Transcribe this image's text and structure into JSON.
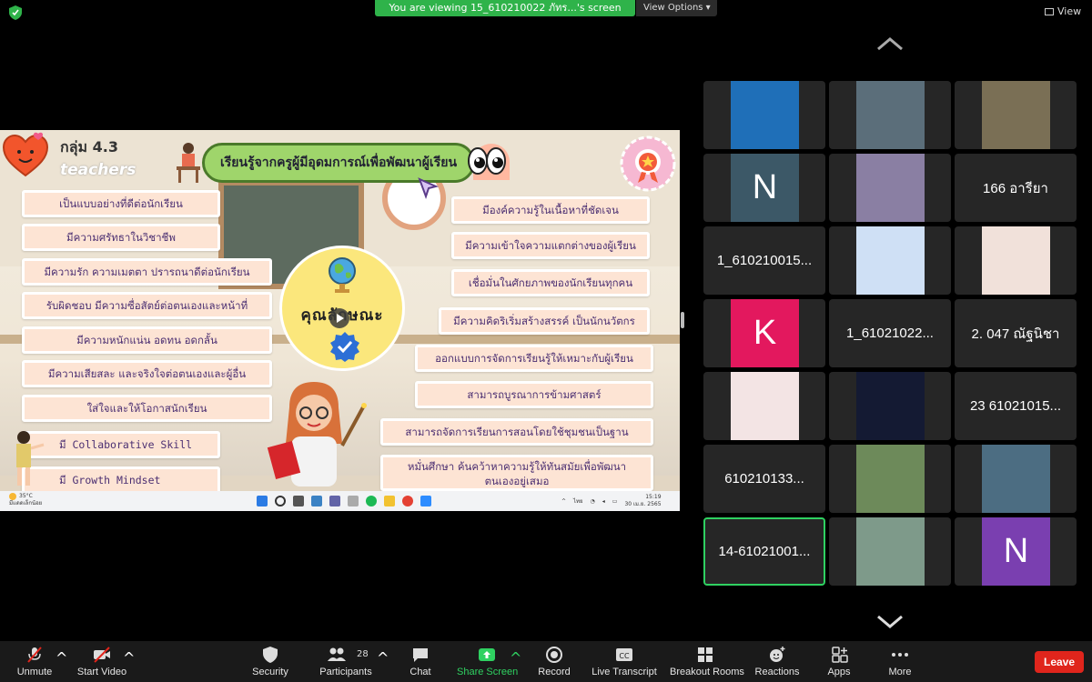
{
  "top_bar": {
    "banner_text": "You are viewing 15_610210022 ภัทร...'s screen",
    "view_options_label": "View Options",
    "view_label": "View"
  },
  "slide": {
    "group_label": "กลุ่ม 4.3",
    "teachers_label": "teachers",
    "title": "เรียนรู้จากครูผู้มีอุดมการณ์เพื่อพัฒนาผู้เรียน",
    "center_title": "คุณลักษณะ",
    "left_items": [
      "เป็นแบบอย่างที่ดีต่อนักเรียน",
      "มีความศรัทธาในวิชาชีพ",
      "มีความรัก ความเมตตา ปรารถนาดีต่อนักเรียน",
      "รับผิดชอบ มีความซื่อสัตย์ต่อตนเองและหน้าที่",
      "มีความหนักแน่น อดทน อดกลั้น",
      "มีความเสียสละ และจริงใจต่อตนเองและผู้อื่น",
      "ใส่ใจและให้โอกาสนักเรียน",
      "มี Collaborative Skill",
      "มี Growth Mindset"
    ],
    "right_items": [
      "มีองค์ความรู้ในเนื้อหาที่ชัดเจน",
      "มีความเข้าใจความแตกต่างของผู้เรียน",
      "เชื่อมั่นในศักยภาพของนักเรียนทุกคน",
      "มีความคิดริเริ่มสร้างสรรค์ เป็นนักนวัตกร",
      "ออกแบบการจัดการเรียนรู้ให้เหมาะกับผู้เรียน",
      "สามารถบูรณาการข้ามศาสตร์",
      "สามารถจัดการเรียนการสอนโดยใช้ชุมชนเป็นฐาน",
      "หมั่นศึกษา ค้นคว้าหาความรู้ให้ทันสมัยเพื่อพัฒนาตนเองอยู่เสมอ"
    ],
    "taskbar": {
      "weather_temp": "35°C",
      "weather_desc": "มีแดดเล็กน้อย",
      "lang": "ไทย",
      "time": "15:19",
      "date": "30 เม.ย. 2565"
    }
  },
  "gallery": [
    {
      "type": "video",
      "label": "",
      "color": "#1f6fb8"
    },
    {
      "type": "video",
      "label": "",
      "color": "#5b6e7a"
    },
    {
      "type": "video",
      "label": "",
      "color": "#7a6f55"
    },
    {
      "type": "avatar",
      "letter": "N",
      "color": "#3c5867"
    },
    {
      "type": "video",
      "label": "",
      "color": "#8a7fa3"
    },
    {
      "type": "name",
      "label": "166 อารียา"
    },
    {
      "type": "name",
      "label": "1_610210015..."
    },
    {
      "type": "video",
      "label": "",
      "color": "#cfe0f5"
    },
    {
      "type": "video",
      "label": "",
      "color": "#f1e1da"
    },
    {
      "type": "avatar",
      "letter": "K",
      "color": "#e3185e"
    },
    {
      "type": "name",
      "label": "1_61021022..."
    },
    {
      "type": "name",
      "label": "2. 047 ณัฐนิชา"
    },
    {
      "type": "video",
      "label": "",
      "color": "#f3e4e4"
    },
    {
      "type": "video",
      "label": "",
      "color": "#141a33"
    },
    {
      "type": "name",
      "label": "23 61021015..."
    },
    {
      "type": "name",
      "label": "610210133..."
    },
    {
      "type": "video",
      "label": "",
      "color": "#6d8a5a"
    },
    {
      "type": "video",
      "label": "",
      "color": "#4c6d82"
    },
    {
      "type": "name",
      "label": "14-61021001...",
      "active": true
    },
    {
      "type": "video",
      "label": "",
      "color": "#7e9a8a"
    },
    {
      "type": "avatar",
      "letter": "N",
      "color": "#7a3fb0"
    }
  ],
  "toolbar": {
    "unmute": "Unmute",
    "start_video": "Start Video",
    "security": "Security",
    "participants": "Participants",
    "participants_count": "28",
    "chat": "Chat",
    "share_screen": "Share Screen",
    "record": "Record",
    "live_transcript": "Live Transcript",
    "breakout_rooms": "Breakout Rooms",
    "reactions": "Reactions",
    "apps": "Apps",
    "more": "More",
    "leave": "Leave"
  },
  "colors": {
    "banner_green": "#2fb34a",
    "share_green": "#2fd161",
    "leave_red": "#e0251c",
    "pill_green": "#9fd56b",
    "item_bg": "#fde4d4"
  }
}
